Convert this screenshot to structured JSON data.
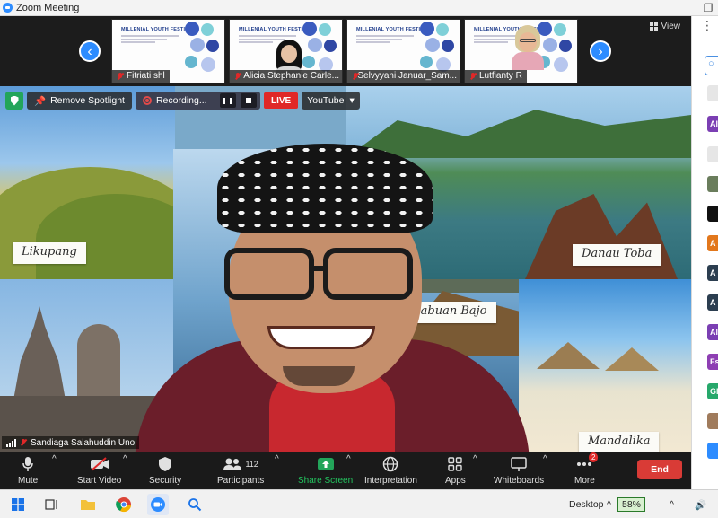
{
  "window": {
    "title": "Zoom Meeting",
    "restore_glyph": "❐"
  },
  "gallery": {
    "slide_banner": "MILLENIAL YOUTH FESTIVAL",
    "participants": [
      {
        "name": "Fitriati shl",
        "muted": true
      },
      {
        "name": "Alicia Stephanie Carle...",
        "muted": true
      },
      {
        "name": "Selvyyani Januar_Sam...",
        "muted": true
      },
      {
        "name": "Lutfianty R",
        "muted": true
      }
    ],
    "prev_arrow": "‹",
    "next_arrow": "›",
    "view_label": "View"
  },
  "top_controls": {
    "remove_spotlight": "Remove Spotlight",
    "recording": "Recording...",
    "live": "LIVE",
    "youtube": "YouTube",
    "dropdown_glyph": "▾"
  },
  "stage": {
    "places": [
      "Likupang",
      "Danau Toba",
      "Labuan Bajo",
      "Mandalika"
    ],
    "speaker_name": "Sandiaga Salahuddin Uno"
  },
  "toolbar": {
    "mute": "Mute",
    "start_video": "Start Video",
    "security": "Security",
    "participants": "Participants",
    "participants_count": "112",
    "share_screen": "Share Screen",
    "interpretation": "Interpretation",
    "apps": "Apps",
    "whiteboards": "Whiteboards",
    "more": "More",
    "more_badge": "2",
    "end": "End",
    "caret": "^"
  },
  "right_panel": {
    "avatars": [
      "Al",
      "A",
      "A",
      "A",
      "Al",
      "Fs",
      "Gl"
    ]
  },
  "taskbar": {
    "desktop": "Desktop",
    "battery": "58%",
    "chevron": "^",
    "volume_glyph": "🔊"
  },
  "colors": {
    "accent": "#2d8cff",
    "live": "#e02828",
    "end": "#d93b36",
    "share": "#23a55a"
  }
}
